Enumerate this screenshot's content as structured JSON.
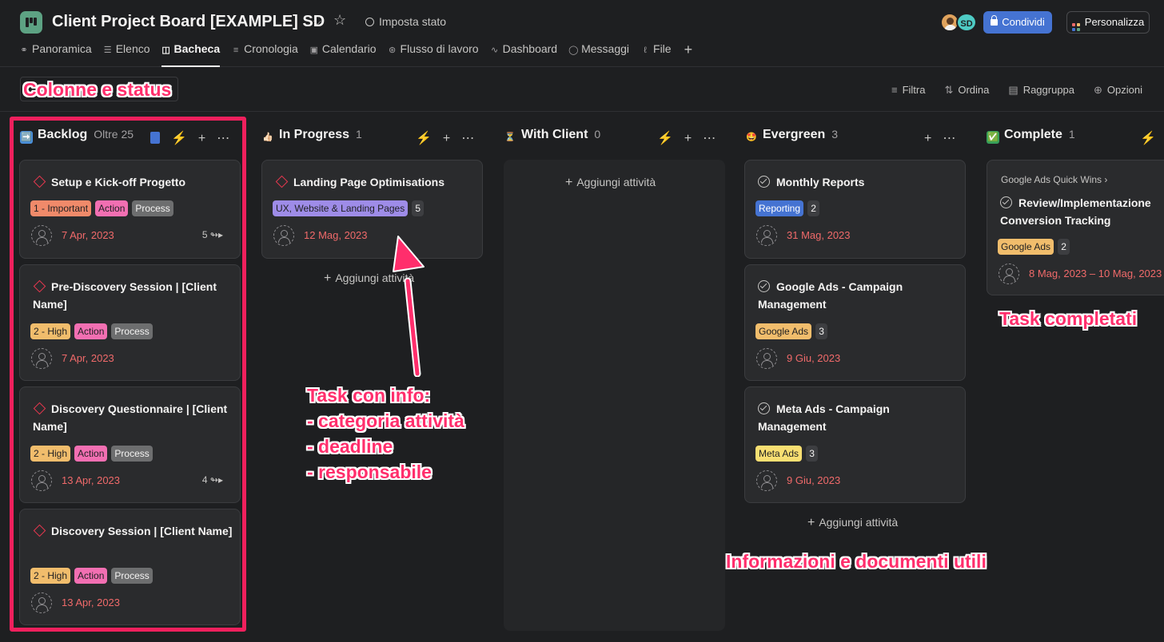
{
  "header": {
    "title": "Client Project Board [EXAMPLE] SD",
    "set_status": "Imposta stato",
    "avatar_initials": "SD",
    "share_label": "Condividi",
    "customize_label": "Personalizza"
  },
  "tabs": [
    {
      "label": "Panoramica",
      "icon": "overview-icon"
    },
    {
      "label": "Elenco",
      "icon": "list-icon"
    },
    {
      "label": "Bacheca",
      "icon": "board-icon",
      "active": true
    },
    {
      "label": "Cronologia",
      "icon": "timeline-icon"
    },
    {
      "label": "Calendario",
      "icon": "calendar-icon"
    },
    {
      "label": "Flusso di lavoro",
      "icon": "workflow-icon"
    },
    {
      "label": "Dashboard",
      "icon": "dashboard-icon"
    },
    {
      "label": "Messaggi",
      "icon": "message-icon"
    },
    {
      "label": "File",
      "icon": "attachment-icon"
    }
  ],
  "toolbar": {
    "filter": "Filtra",
    "sort": "Ordina",
    "group": "Raggruppa",
    "options": "Opzioni"
  },
  "annotations": {
    "columns": "Colonne e status",
    "task_info": [
      "Task con info:",
      "- categoria attività",
      "- deadline",
      "- responsabile"
    ],
    "completed": "Task completati",
    "useful_info": "Informazioni e documenti utili"
  },
  "add_task_label": "Aggiungi attività",
  "colors": {
    "accent": "#4573d2",
    "annotation": "#ff2e6c",
    "due_date": "#f06a6a",
    "tag_important": "#f08a6a",
    "tag_high": "#f1bd6c",
    "tag_action": "#f26fb2",
    "tag_process": "#6d6e6f",
    "tag_ux": "#9e8ce8",
    "tag_reporting": "#4573d2",
    "tag_google_ads": "#f1bd6c",
    "tag_meta_ads": "#f8df72"
  },
  "columns": [
    {
      "name": "Backlog",
      "emoji": "➡️",
      "count": "Oltre 25",
      "cards": [
        {
          "title": "Setup e Kick-off Progetto",
          "tags": [
            "1 - Important",
            "Action",
            "Process"
          ],
          "date": "7 Apr, 2023",
          "subtasks": "5"
        },
        {
          "title": "Pre-Discovery Session | [Client Name]",
          "tags": [
            "2 - High",
            "Action",
            "Process"
          ],
          "date": "7 Apr, 2023"
        },
        {
          "title": "Discovery Questionnaire | [Client Name]",
          "tags": [
            "2 - High",
            "Action",
            "Process"
          ],
          "date": "13 Apr, 2023",
          "subtasks": "4"
        },
        {
          "title": "Discovery Session | [Client Name]",
          "tags": [
            "2 - High",
            "Action",
            "Process"
          ],
          "date": "13 Apr, 2023"
        }
      ]
    },
    {
      "name": "In Progress",
      "emoji": "👍🏻",
      "count": "1",
      "cards": [
        {
          "title": "Landing Page Optimisations",
          "tags": [
            "UX, Website & Landing Pages"
          ],
          "tag_count": "5",
          "date": "12 Mag, 2023"
        }
      ]
    },
    {
      "name": "With Client",
      "emoji": "⏳",
      "count": "0",
      "cards": []
    },
    {
      "name": "Evergreen",
      "emoji": "🤩",
      "count": "3",
      "cards": [
        {
          "title": "Monthly Reports",
          "tags": [
            "Reporting"
          ],
          "tag_count": "2",
          "date": "31 Mag, 2023"
        },
        {
          "title": "Google Ads - Campaign Management",
          "tags": [
            "Google Ads"
          ],
          "tag_count": "3",
          "date": "9 Giu, 2023"
        },
        {
          "title": "Meta Ads - Campaign Management",
          "tags": [
            "Meta Ads"
          ],
          "tag_count": "3",
          "date": "9 Giu, 2023"
        }
      ]
    },
    {
      "name": "Complete",
      "emoji": "✅",
      "count": "1",
      "cards": [
        {
          "parent": "Google Ads Quick Wins",
          "title": "Review/Implementazione Conversion Tracking",
          "tags": [
            "Google Ads"
          ],
          "tag_count": "2",
          "date": "8 Mag, 2023 – 10 Mag, 2023"
        }
      ]
    }
  ]
}
